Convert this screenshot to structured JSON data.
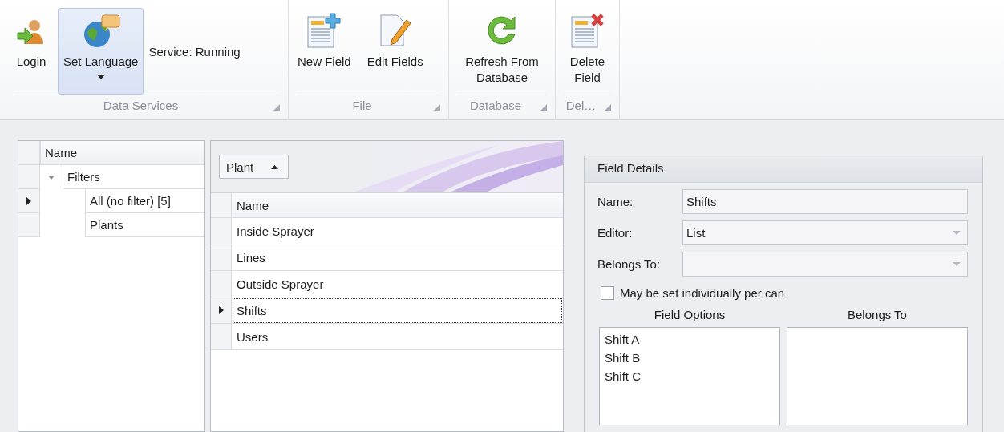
{
  "ribbon": {
    "groups": [
      {
        "label": "Data Services",
        "items": [
          {
            "kind": "button",
            "label": "Login",
            "selected": false,
            "dropdown": false
          },
          {
            "kind": "button",
            "label": "Set Language",
            "selected": true,
            "dropdown": true
          },
          {
            "kind": "status",
            "label": "Service: Running"
          }
        ]
      },
      {
        "label": "File",
        "items": [
          {
            "kind": "button",
            "label": "New Field",
            "selected": false,
            "dropdown": false
          },
          {
            "kind": "button",
            "label": "Edit Fields",
            "selected": false,
            "dropdown": false
          }
        ]
      },
      {
        "label": "Database",
        "items": [
          {
            "kind": "button",
            "label": "Refresh From Database",
            "selected": false,
            "dropdown": false
          }
        ]
      },
      {
        "label": "Del…",
        "items": [
          {
            "kind": "button",
            "label": "Delete Field",
            "selected": false,
            "dropdown": false
          }
        ]
      }
    ]
  },
  "tree": {
    "column": "Name",
    "nodes": [
      {
        "label": "Filters",
        "expanded": true,
        "selected": false,
        "children": [
          {
            "label": "All (no filter) [5]",
            "selected": true
          },
          {
            "label": "Plants",
            "selected": false
          }
        ]
      }
    ]
  },
  "grid": {
    "group_by": {
      "label": "Plant"
    },
    "column": "Name",
    "rows": [
      {
        "name": "Inside Sprayer",
        "selected": false
      },
      {
        "name": "Lines",
        "selected": false
      },
      {
        "name": "Outside Sprayer",
        "selected": false
      },
      {
        "name": "Shifts",
        "selected": true
      },
      {
        "name": "Users",
        "selected": false
      }
    ]
  },
  "details": {
    "title": "Field Details",
    "fields": [
      {
        "label": "Name:",
        "kind": "text",
        "value": "Shifts"
      },
      {
        "label": "Editor:",
        "kind": "dropdown",
        "value": "List"
      },
      {
        "label": "Belongs To:",
        "kind": "dropdown"
      }
    ],
    "checkbox": {
      "label": "May be set individually per can",
      "checked": false
    },
    "lists": [
      {
        "title": "Field Options",
        "items": [
          "Shift A",
          "Shift B",
          "Shift C"
        ]
      },
      {
        "title": "Belongs To"
      }
    ]
  }
}
